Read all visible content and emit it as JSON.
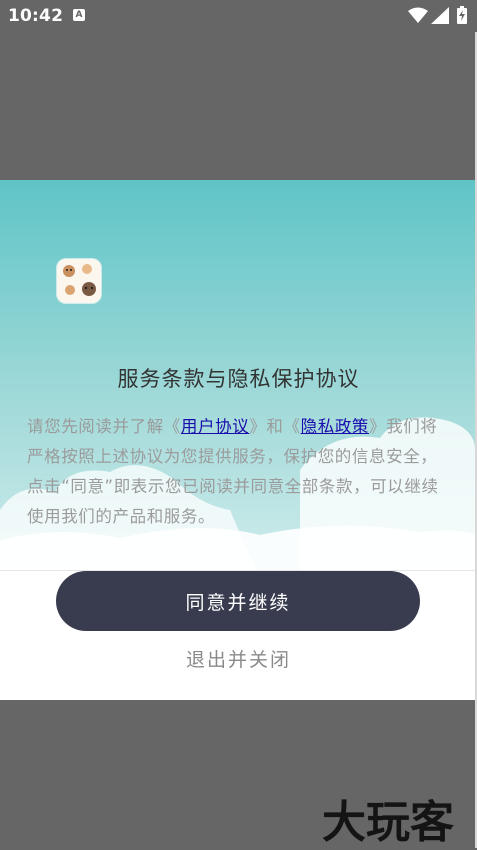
{
  "status_bar": {
    "time": "10:42",
    "notification_glyph": "A",
    "icons": [
      "notification-icon",
      "wifi-icon",
      "cell-signal-icon",
      "battery-charging-icon"
    ]
  },
  "dialog": {
    "title": "服务条款与隐私保护协议",
    "body": {
      "prefix": "请您先阅读并了解《",
      "link_user_agreement": "用户协议",
      "middle": "》和《",
      "link_privacy_policy": "隐私政策",
      "suffix": "》我们将严格按照上述协议为您提供服务，保护您的信息安全，点击“同意”即表示您已阅读并同意全部条款，可以继续使用我们的产品和服务。"
    },
    "agree_button": "同意并继续",
    "exit_button": "退出并关闭"
  },
  "watermark": "大玩客",
  "colors": {
    "overlay": "#666666",
    "header_gradient_top": "#5fc4c6",
    "primary_button": "#393c4f",
    "link": "#1a0dab",
    "body_text": "#9b9b9b"
  }
}
